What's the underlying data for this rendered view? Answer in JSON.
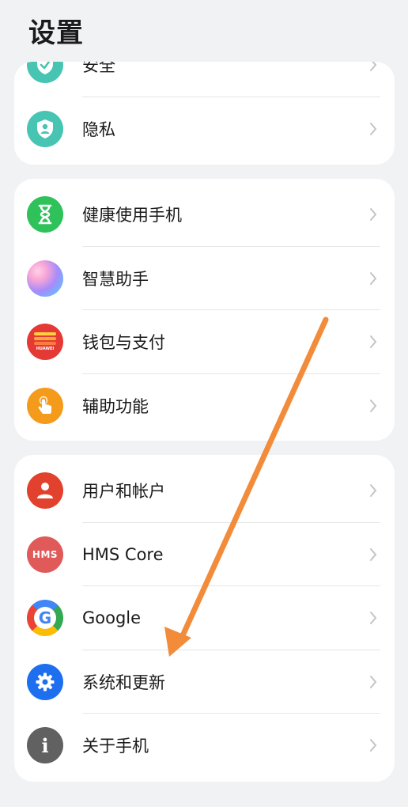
{
  "header": {
    "title": "设置"
  },
  "groups": [
    {
      "items": [
        {
          "label": "安全",
          "icon": "shield-check-icon",
          "color": "#47c5b2"
        },
        {
          "label": "隐私",
          "icon": "privacy-shield-icon",
          "color": "#47c5b2"
        }
      ]
    },
    {
      "items": [
        {
          "label": "健康使用手机",
          "icon": "hourglass-icon",
          "color": "#2fc25a"
        },
        {
          "label": "智慧助手",
          "icon": "assistant-orb-icon",
          "color": "#a78bfa"
        },
        {
          "label": "钱包与支付",
          "icon": "wallet-icon",
          "color": "#e53935",
          "icon_text": "HUAWEI"
        },
        {
          "label": "辅助功能",
          "icon": "hand-pointer-icon",
          "color": "#f59b1c"
        }
      ]
    },
    {
      "items": [
        {
          "label": "用户和帐户",
          "icon": "user-icon",
          "color": "#e2412e"
        },
        {
          "label": "HMS Core",
          "icon": "hms-icon",
          "color": "#e05a5a",
          "icon_text": "HMS"
        },
        {
          "label": "Google",
          "icon": "google-icon",
          "color": "#4285f4",
          "icon_text": "G"
        },
        {
          "label": "系统和更新",
          "icon": "gear-icon",
          "color": "#1e6ff0"
        },
        {
          "label": "关于手机",
          "icon": "info-icon",
          "color": "#616161",
          "icon_text": "i"
        }
      ]
    }
  ],
  "annotation": {
    "arrow_color": "#f28c3a"
  }
}
